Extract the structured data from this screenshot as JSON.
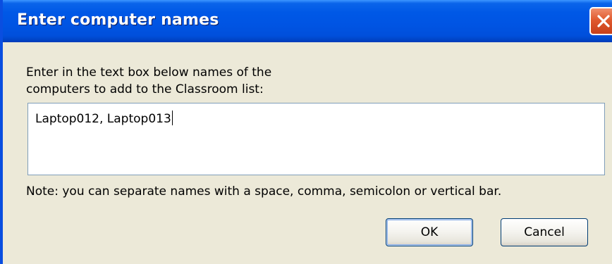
{
  "window": {
    "title": "Enter computer names",
    "close_icon": "close-icon"
  },
  "dialog": {
    "prompt_line1": "Enter in the text box below names of the",
    "prompt_line2": "computers to add to the Classroom list:",
    "input_value": "Laptop012, Laptop013",
    "note": "Note: you can separate names with a space, comma, semicolon or vertical bar."
  },
  "buttons": {
    "ok_label": "OK",
    "cancel_label": "Cancel"
  },
  "colors": {
    "titlebar": "#0054e3",
    "dialog_background": "#ece9d8",
    "close_button": "#e05a2e",
    "textbox_border": "#7f9db9"
  }
}
